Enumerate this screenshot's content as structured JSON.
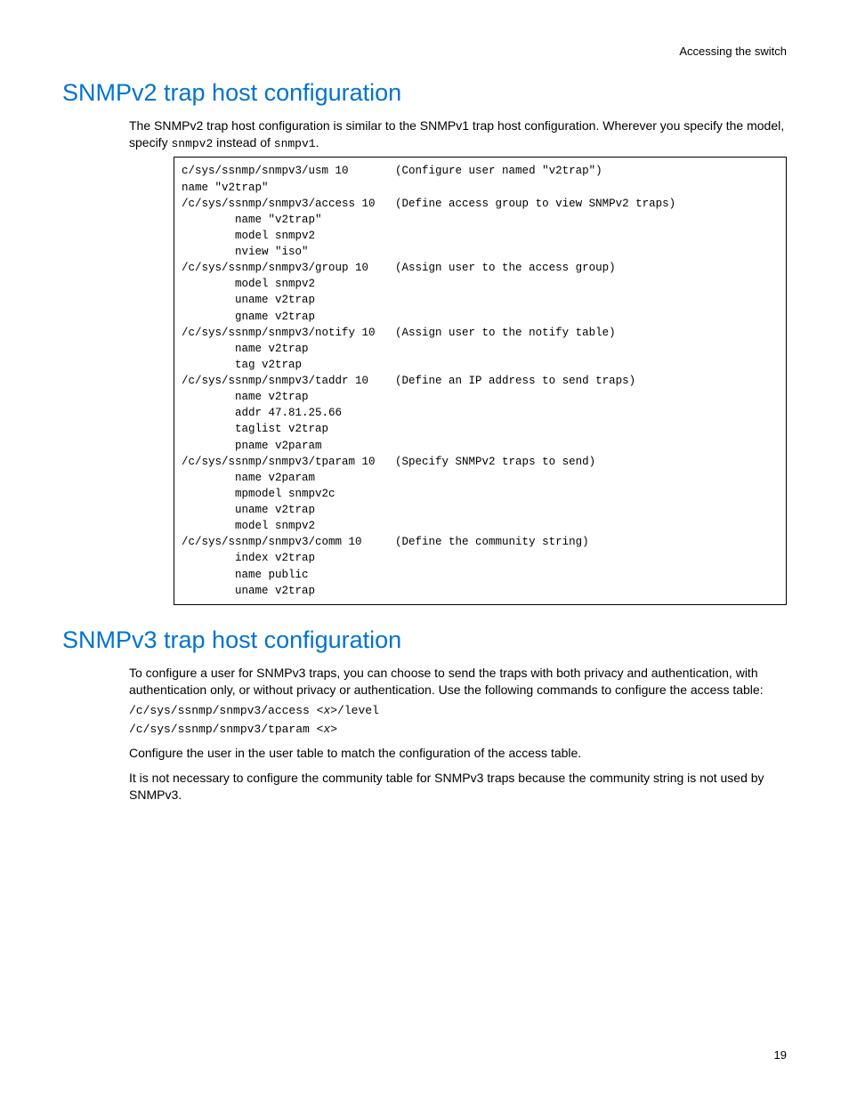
{
  "header": {
    "right": "Accessing the switch"
  },
  "sec1": {
    "title": "SNMPv2 trap host configuration",
    "intro_before": "The SNMPv2 trap host configuration is similar to the SNMPv1 trap host configuration. Wherever you specify the model, specify ",
    "code1": "snmpv2",
    "intro_mid": " instead of ",
    "code2": "snmpv1",
    "intro_after": ".",
    "codebox": "c/sys/ssnmp/snmpv3/usm 10       (Configure user named \"v2trap\")\nname \"v2trap\"\n/c/sys/ssnmp/snmpv3/access 10   (Define access group to view SNMPv2 traps)\n        name \"v2trap\"\n        model snmpv2\n        nview \"iso\"\n/c/sys/ssnmp/snmpv3/group 10    (Assign user to the access group)\n        model snmpv2\n        uname v2trap\n        gname v2trap\n/c/sys/ssnmp/snmpv3/notify 10   (Assign user to the notify table)\n        name v2trap\n        tag v2trap\n/c/sys/ssnmp/snmpv3/taddr 10    (Define an IP address to send traps)\n        name v2trap\n        addr 47.81.25.66\n        taglist v2trap\n        pname v2param\n/c/sys/ssnmp/snmpv3/tparam 10   (Specify SNMPv2 traps to send)\n        name v2param\n        mpmodel snmpv2c\n        uname v2trap\n        model snmpv2\n/c/sys/ssnmp/snmpv3/comm 10     (Define the community string)\n        index v2trap\n        name public\n        uname v2trap"
  },
  "sec2": {
    "title": "SNMPv3 trap host configuration",
    "p1": "To configure a user for SNMPv3 traps, you can choose to send the traps with both privacy and authentication, with authentication only, or without privacy or authentication. Use the following commands to configure the access table:",
    "cmd1_pre": "/c/sys/ssnmp/snmpv3/access <",
    "cmd1_var": "x",
    "cmd1_post": ">/level",
    "cmd2_pre": "/c/sys/ssnmp/snmpv3/tparam <",
    "cmd2_var": "x",
    "cmd2_post": ">",
    "p2": "Configure the user in the user table to match the configuration of the access table.",
    "p3": "It is not necessary to configure the community table for SNMPv3 traps because the community string is not used by SNMPv3."
  },
  "page": "19"
}
